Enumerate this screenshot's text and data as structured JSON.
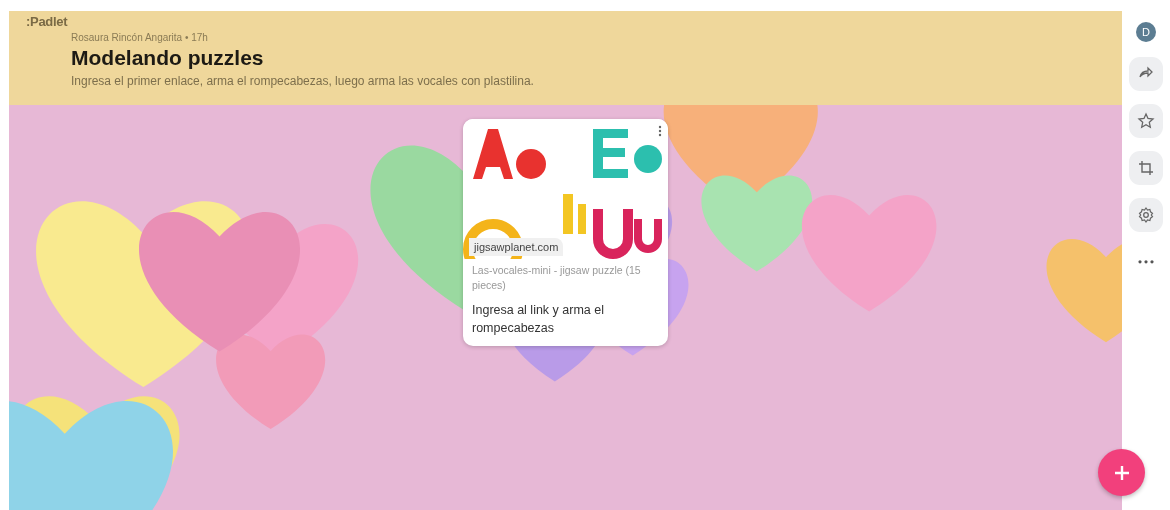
{
  "logo": ":Padlet",
  "header": {
    "meta": "Rosaura Rincón Angarita • 17h",
    "title": "Modelando puzzles",
    "description": "Ingresa el primer enlace, arma el rompecabezas, luego arma las vocales con plastilina."
  },
  "posts": [
    {
      "domain": "jigsawplanet.com",
      "link_title": "Las-vocales-mini - jigsaw puzzle (15 pieces)",
      "body": "Ingresa al link y arma el rompecabezas"
    }
  ],
  "sidebar": {
    "avatar": "D",
    "buttons": [
      {
        "kind": "share"
      },
      {
        "kind": "star"
      },
      {
        "kind": "crop"
      },
      {
        "kind": "settings"
      },
      {
        "kind": "more"
      }
    ]
  },
  "add_button": {
    "kind": "plus"
  }
}
